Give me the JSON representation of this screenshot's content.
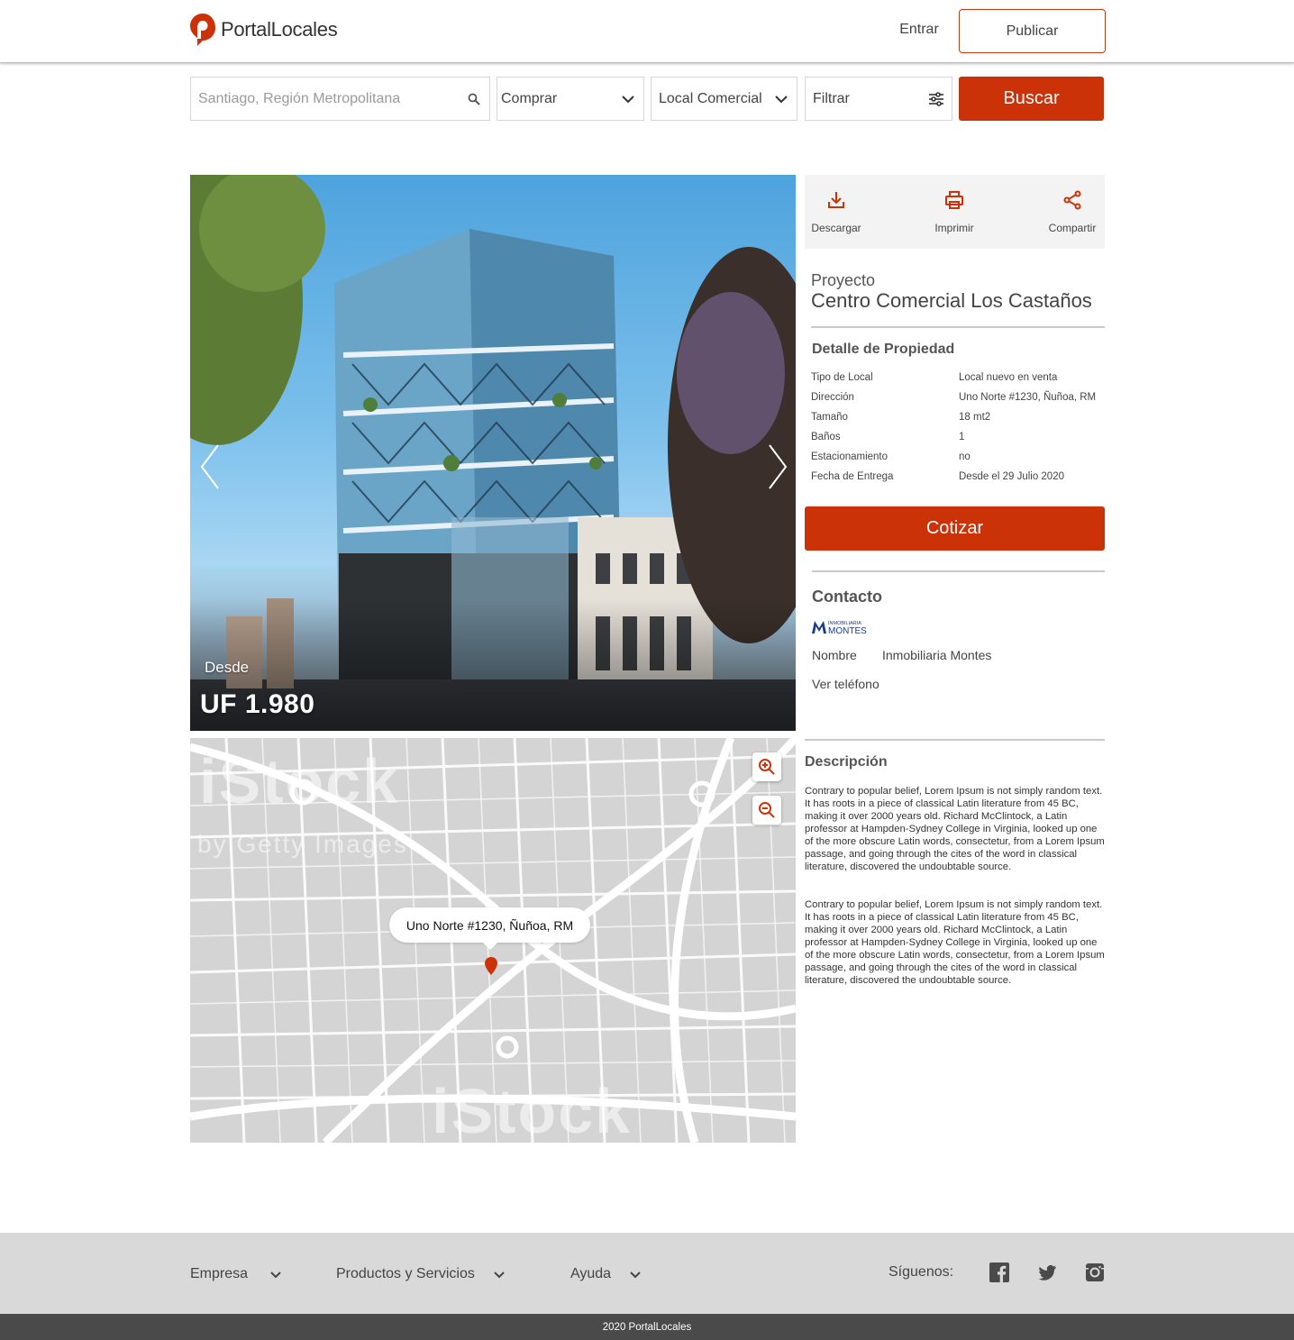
{
  "brand": {
    "name": "PortalLocales",
    "accent": "#cc3208"
  },
  "header": {
    "login": "Entrar",
    "publish": "Publicar"
  },
  "search": {
    "location_placeholder": "Santiago, Región Metropolitana",
    "operation": "Comprar",
    "property_type": "Local Comercial",
    "filter": "Filtrar",
    "submit": "Buscar"
  },
  "listing": {
    "price_label": "Desde",
    "price": "UF 1.980",
    "actions": [
      {
        "label": "Descargar",
        "icon": "download-icon"
      },
      {
        "label": "Imprimir",
        "icon": "print-icon"
      },
      {
        "label": "Compartir",
        "icon": "share-icon"
      }
    ],
    "project_label": "Proyecto",
    "project_name": "Centro Comercial Los Castaños",
    "details_title": "Detalle de Propiedad",
    "details": [
      {
        "key": "Tipo de Local",
        "value": "Local nuevo en venta"
      },
      {
        "key": "Dirección",
        "value": "Uno Norte #1230, Ñuñoa, RM"
      },
      {
        "key": "Tamaño",
        "value": "18 mt2"
      },
      {
        "key": "Baños",
        "value": "1"
      },
      {
        "key": "Estacionamiento",
        "value": "no"
      },
      {
        "key": "Fecha de Entrega",
        "value": "Desde el 29 Julio 2020"
      }
    ],
    "quote_button": "Cotizar"
  },
  "contact": {
    "title": "Contacto",
    "agency_logo_top": "INMOBILIARIA",
    "agency_logo_name": "MONTES",
    "name_label": "Nombre",
    "name_value": "Inmobiliaria Montes",
    "phone_link": "Ver teléfono"
  },
  "description": {
    "title": "Descripción",
    "paragraphs": [
      "Contrary to popular belief, Lorem Ipsum is not simply random text. It has roots in a piece of classical Latin literature from 45 BC, making it over 2000 years old. Richard McClintock, a Latin professor at Hampden-Sydney College in Virginia, looked up one of the more obscure Latin words, consectetur, from a Lorem Ipsum passage, and going through the cites of the word in classical literature, discovered the undoubtable source.",
      "Contrary to popular belief, Lorem Ipsum is not simply random text. It has roots in a piece of classical Latin literature from 45 BC, making it over 2000 years old. Richard McClintock, a Latin professor at Hampden-Sydney College in Virginia, looked up one of the more obscure Latin words, consectetur, from a Lorem Ipsum passage, and going through the cites of the word in classical literature, discovered the undoubtable source."
    ]
  },
  "map": {
    "address_bubble": "Uno Norte #1230, Ñuñoa, RM",
    "watermark": "iStock",
    "watermark_sub": "by Getty Images"
  },
  "footer": {
    "menus": [
      "Empresa",
      "Productos y Servicios",
      "Ayuda"
    ],
    "follow": "Síguenos:",
    "social": [
      "facebook-icon",
      "twitter-icon",
      "instagram-icon"
    ],
    "copyright": "2020 PortalLocales"
  }
}
